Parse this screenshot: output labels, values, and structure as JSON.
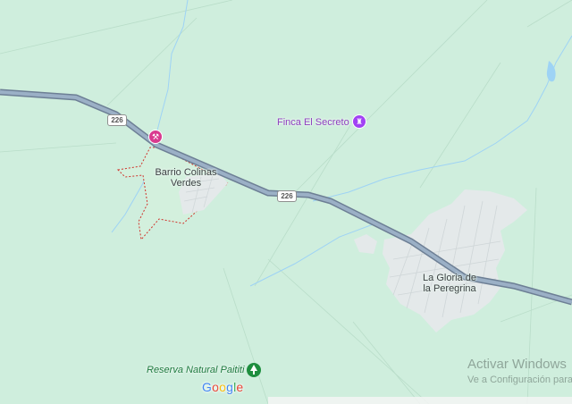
{
  "map": {
    "places": {
      "barrio": "Barrio Colinas\nVerdes",
      "barrio_line1": "Barrio Colinas",
      "barrio_line2": "Verdes",
      "gloria_line1": "La Gloria de",
      "gloria_line2": "la Peregrina"
    },
    "pois": {
      "finca": "Finca El Secreto",
      "reserva": "Reserva Natural Paititi"
    },
    "route_shields": [
      "226",
      "226"
    ],
    "google_logo": [
      "G",
      "o",
      "o",
      "g",
      "l",
      "e"
    ],
    "google_colors": [
      "#4285F4",
      "#EA4335",
      "#FBBC05",
      "#4285F4",
      "#34A853",
      "#EA4335"
    ],
    "colors": {
      "land": "#cfeedd",
      "highway": "#8a9db3",
      "urban": "#e4e9ea",
      "poi_purple": "#a142f4",
      "poi_pink": "#d93a8f",
      "park_green": "#1e8e3e",
      "water": "#9ed3f5"
    },
    "icons": [
      "pickaxe-icon",
      "castle-icon",
      "tree-icon"
    ]
  },
  "watermark": {
    "title": "Activar Windows",
    "subtitle": "Ve a Configuración para"
  }
}
